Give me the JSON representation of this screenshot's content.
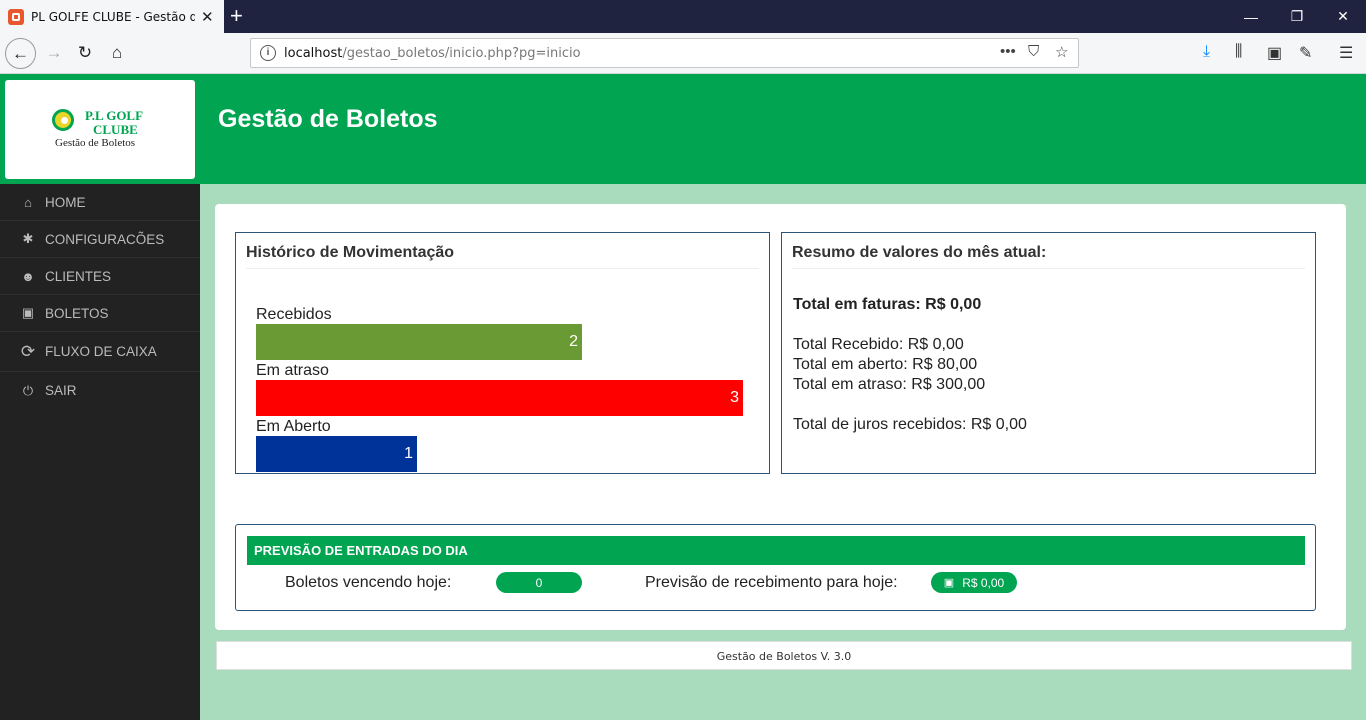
{
  "browser": {
    "tab_title": "PL GOLFE CLUBE - Gestão de Boletos",
    "url_host": "localhost",
    "url_path": "/gestao_boletos/inicio.php?pg=inicio"
  },
  "logo": {
    "line1": "P.L GOLF",
    "line2": "CLUBE",
    "subtitle": "Gestão de Boletos"
  },
  "header": {
    "title": "Gestão de Boletos"
  },
  "sidebar": {
    "items": [
      {
        "label": "HOME",
        "icon": "home-icon"
      },
      {
        "label": "CONFIGURACÕES",
        "icon": "gear-icon"
      },
      {
        "label": "CLIENTES",
        "icon": "users-icon"
      },
      {
        "label": "BOLETOS",
        "icon": "money-icon"
      },
      {
        "label": "FLUXO DE CAIXA",
        "icon": "refresh-icon"
      },
      {
        "label": "SAIR",
        "icon": "power-icon"
      }
    ]
  },
  "history": {
    "title": "Histórico de Movimentação",
    "bars": [
      {
        "label": "Recebidos",
        "value": "2",
        "color": "#6a9a34"
      },
      {
        "label": "Em atraso",
        "value": "3",
        "color": "#ff0000"
      },
      {
        "label": "Em Aberto",
        "value": "1",
        "color": "#003399"
      }
    ]
  },
  "summary": {
    "title": "Resumo de valores do mês atual:",
    "total_invoices": "Total em faturas: R$ 0,00",
    "received": "Total Recebido: R$ 0,00",
    "open": "Total em aberto: R$ 80,00",
    "overdue": "Total em atraso: R$ 300,00",
    "interest": "Total de juros recebidos: R$ 0,00"
  },
  "forecast": {
    "title": "PREVISÃO DE ENTRADAS DO DIA",
    "due_today_label": "Boletos vencendo hoje:",
    "due_today_value": "0",
    "expected_label": "Previsão de recebimento para hoje:",
    "expected_value": "R$ 0,00"
  },
  "footer": {
    "text": "Gestão de Boletos V. 3.0"
  },
  "colors": {
    "brand_green": "#00a451",
    "sidebar_bg": "#222222",
    "page_bg": "#a8dcbc"
  }
}
